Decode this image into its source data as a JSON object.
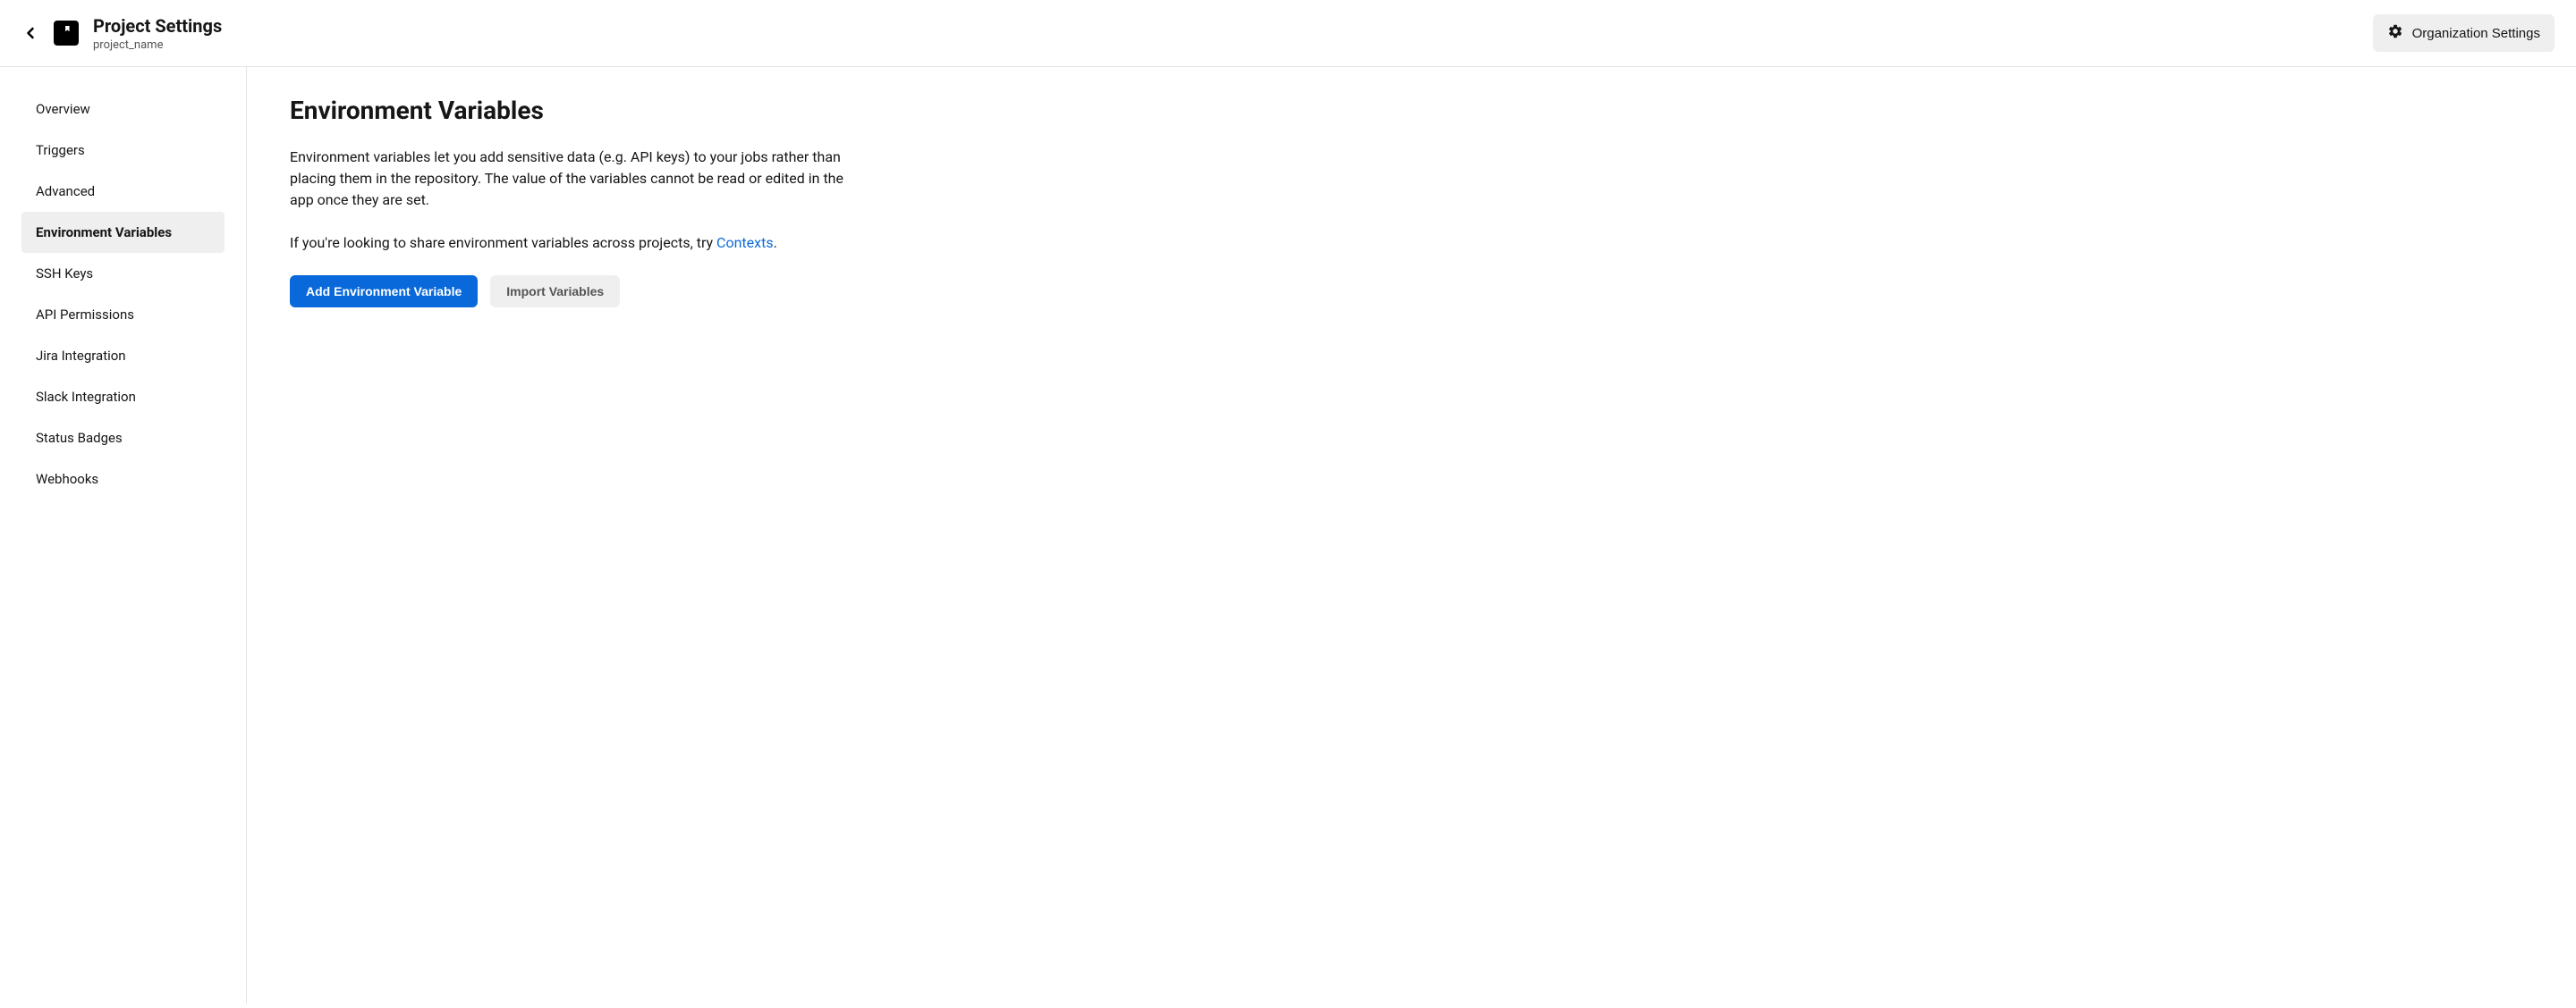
{
  "header": {
    "title": "Project Settings",
    "project_name": "project_name",
    "org_settings_label": "Organization Settings"
  },
  "sidebar": {
    "items": [
      {
        "label": "Overview",
        "active": false
      },
      {
        "label": "Triggers",
        "active": false
      },
      {
        "label": "Advanced",
        "active": false
      },
      {
        "label": "Environment Variables",
        "active": true
      },
      {
        "label": "SSH Keys",
        "active": false
      },
      {
        "label": "API Permissions",
        "active": false
      },
      {
        "label": "Jira Integration",
        "active": false
      },
      {
        "label": "Slack Integration",
        "active": false
      },
      {
        "label": "Status Badges",
        "active": false
      },
      {
        "label": "Webhooks",
        "active": false
      }
    ]
  },
  "main": {
    "heading": "Environment Variables",
    "description": "Environment variables let you add sensitive data (e.g. API keys) to your jobs rather than placing them in the repository. The value of the variables cannot be read or edited in the app once they are set.",
    "share_text_prefix": "If you're looking to share environment variables across projects, try ",
    "contexts_link_label": "Contexts",
    "share_text_suffix": ".",
    "add_button_label": "Add Environment Variable",
    "import_button_label": "Import Variables"
  }
}
